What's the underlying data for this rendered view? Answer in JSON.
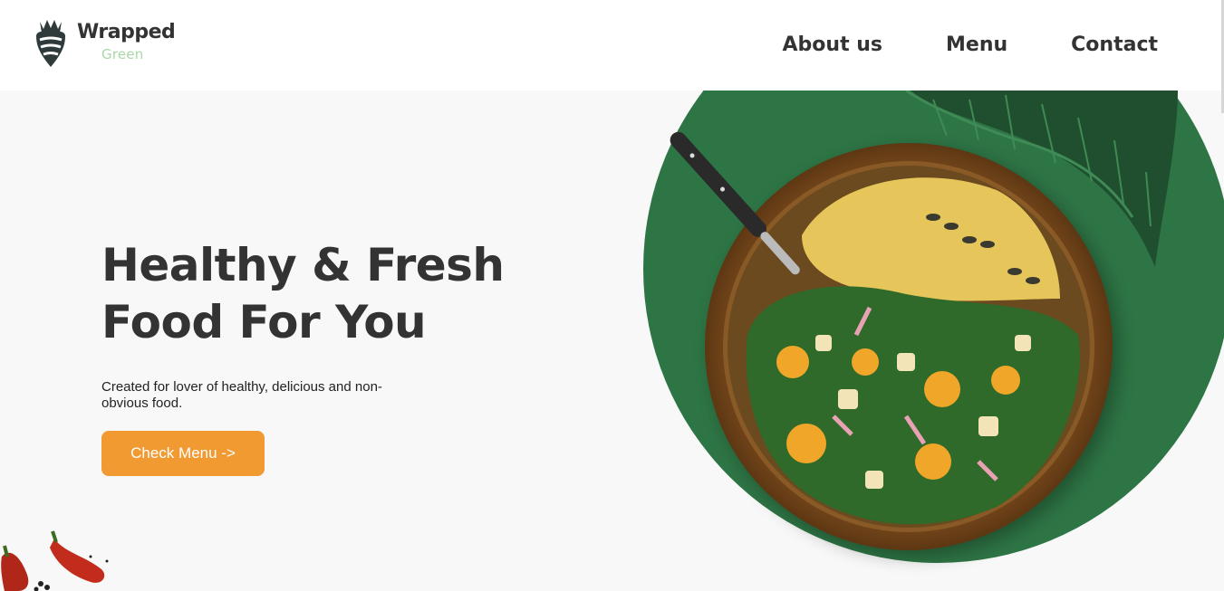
{
  "brand": {
    "name": "Wrapped",
    "tagline": "Green",
    "colors": {
      "primary_green": "#2e7545",
      "accent_orange": "#f19a32",
      "text_dark": "#333333",
      "logo_light_green": "#a8d7a8"
    }
  },
  "nav": {
    "items": [
      {
        "label": "About us"
      },
      {
        "label": "Menu"
      },
      {
        "label": "Contact"
      }
    ]
  },
  "hero": {
    "title_line1": "Healthy & Fresh",
    "title_line2": "Food For You",
    "subtitle": "Created for lover of healthy, delicious and non-obvious food.",
    "cta_label": "Check Menu ->"
  },
  "imagery": {
    "main": "salad-bowl-image",
    "leaf": "monstera-leaf-icon",
    "bottom_left": "chili-peppers-image"
  }
}
